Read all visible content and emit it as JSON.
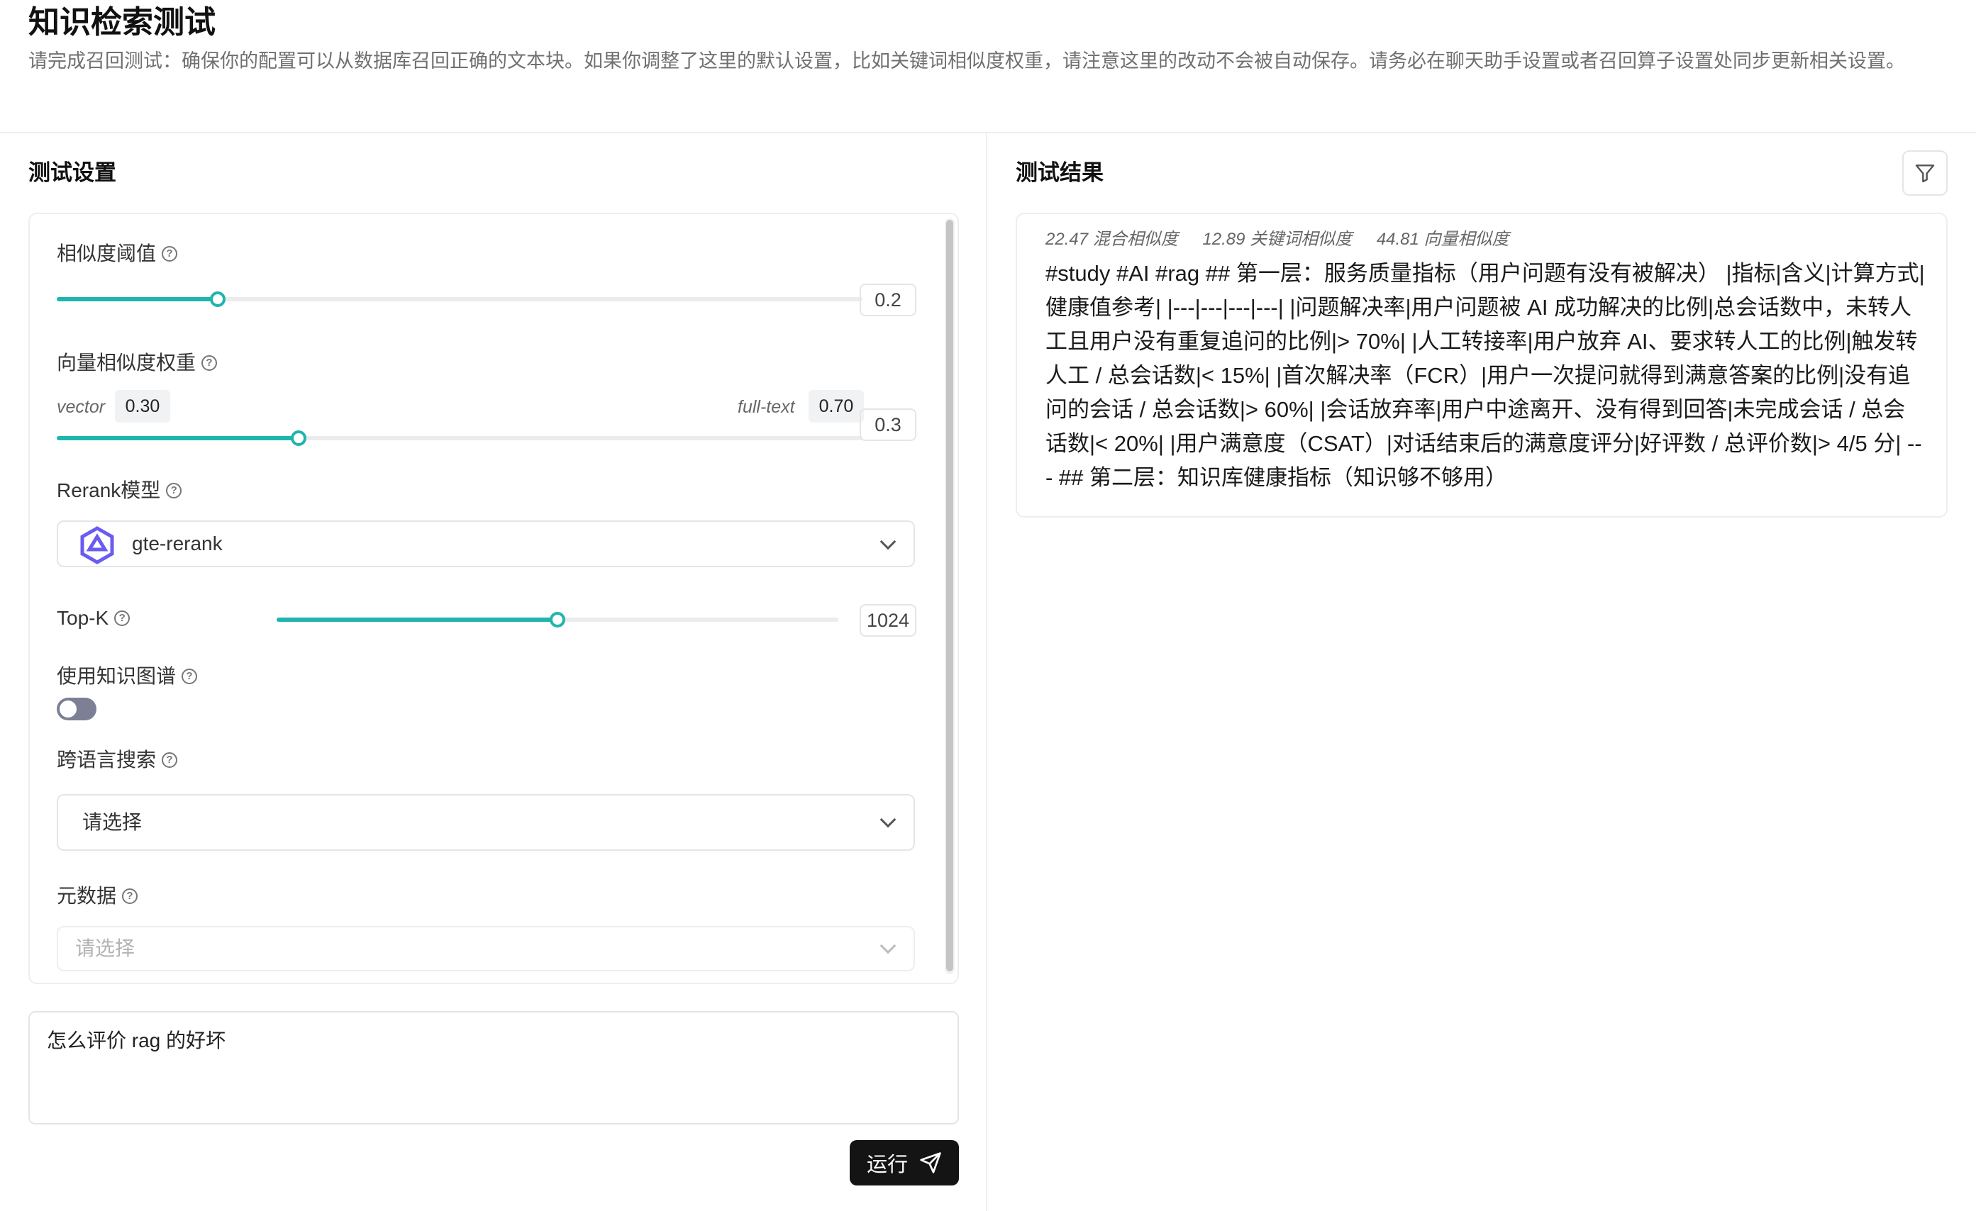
{
  "header": {
    "title": "知识检索测试",
    "description": "请完成召回测试：确保你的配置可以从数据库召回正确的文本块。如果你调整了这里的默认设置，比如关键词相似度权重，请注意这里的改动不会被自动保存。请务必在聊天助手设置或者召回算子设置处同步更新相关设置。"
  },
  "settings": {
    "section_title": "测试设置",
    "similarity_threshold": {
      "label": "相似度阈值",
      "value": "0.2",
      "fraction": 0.2
    },
    "vector_weight": {
      "label": "向量相似度权重",
      "vector_label": "vector",
      "vector_value": "0.30",
      "fulltext_label": "full-text",
      "fulltext_value": "0.70",
      "value": "0.3",
      "fraction": 0.3
    },
    "rerank": {
      "label": "Rerank模型",
      "value": "gte-rerank"
    },
    "topk": {
      "label": "Top-K",
      "value": "1024",
      "fraction": 0.5
    },
    "knowledge_graph": {
      "label": "使用知识图谱",
      "enabled": false
    },
    "cross_language": {
      "label": "跨语言搜索",
      "placeholder": "请选择"
    },
    "metadata": {
      "label": "元数据",
      "placeholder": "请选择"
    },
    "query": "怎么评价 rag 的好坏",
    "run_label": "运行"
  },
  "results": {
    "section_title": "测试结果",
    "items": [
      {
        "hybrid_score": "22.47 混合相似度",
        "keyword_score": "12.89 关键词相似度",
        "vector_score": "44.81 向量相似度",
        "content": "#study #AI #rag ## 第一层：服务质量指标（用户问题有没有被解决） |指标|含义|计算方式|健康值参考| |---|---|---|---| |问题解决率|用户问题被 AI 成功解决的比例|总会话数中，未转人工且用户没有重复追问的比例|> 70%| |人工转接率|用户放弃 AI、要求转人工的比例|触发转人工 / 总会话数|< 15%| |首次解决率（FCR）|用户一次提问就得到满意答案的比例|没有追问的会话 / 总会话数|> 60%| |会话放弃率|用户中途离开、没有得到回答|未完成会话 / 总会话数|< 20%| |用户满意度（CSAT）|对话结束后的满意度评分|好评数 / 总评价数|> 4/5 分| --- ## 第二层：知识库健康指标（知识够不够用）"
      }
    ]
  },
  "colors": {
    "accent": "#1fb5ad",
    "button_bg": "#141414"
  }
}
